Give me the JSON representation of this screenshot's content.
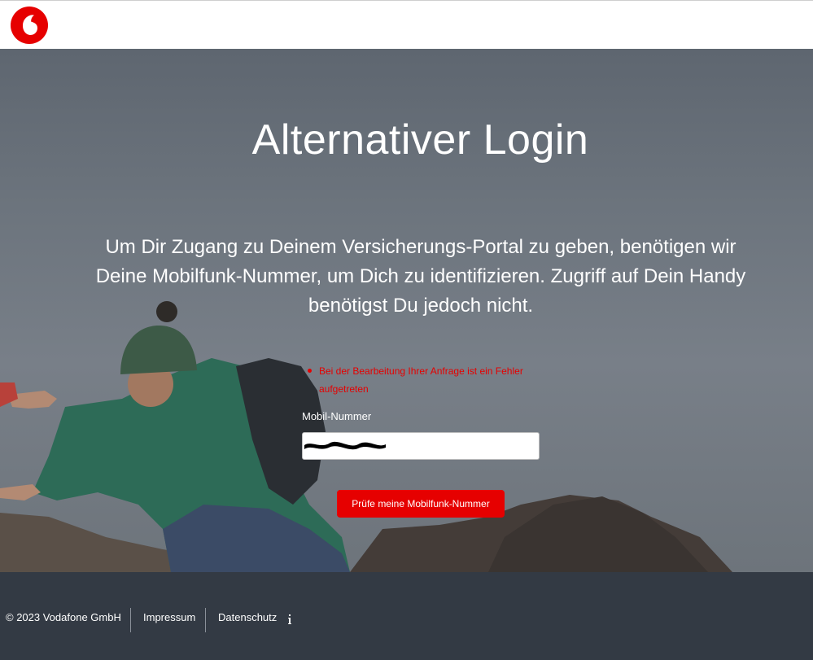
{
  "header": {
    "logo": {
      "icon": "vodafone-logo-icon",
      "color": "#e60000"
    }
  },
  "hero": {
    "title": "Alternativer Login",
    "intro_lines": [
      "Um Dir Zugang zu Deinem Versicherungs-Portal zu geben, benötigen wir",
      "Deine Mobilfunk-Nummer, um Dich zu identifizieren. Zugriff auf Dein Handy",
      "benötigst Du jedoch nicht."
    ]
  },
  "form": {
    "errors": [
      "Bei der Bearbeitung Ihrer Anfrage ist ein Fehler",
      "aufgetreten"
    ],
    "phone_label": "Mobil-Nummer",
    "phone_value": "",
    "submit_label": "Prüfe meine Mobilfunk-Nummer"
  },
  "footer": {
    "copyright": "© 2023 Vodafone GmbH",
    "imprint": "Impressum",
    "privacy": "Datenschutz",
    "info_icon": "info-icon"
  },
  "colors": {
    "brand_red": "#e60000",
    "footer_bg": "#333a44",
    "hero_bg": "#6c747d"
  }
}
